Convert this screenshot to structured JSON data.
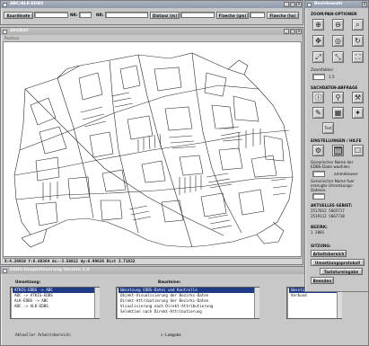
{
  "top_window": {
    "title": "ABC/ALK-EDBS",
    "koordinate_label": "Koordinate",
    "nr_label": "NR:",
    "nr2_label": "NR:",
    "distanz_label": "Distanz (m)",
    "flaeche_label": "Flaeche (qm)",
    "flaeche2_label": "Flaeche (ha)"
  },
  "map_window": {
    "title": "AKGRAF",
    "menu_label": "Position",
    "status_text": "X:4.26919 Y:6.88364 dx:-3.58812 dy:0.99636 Dist 3.71632"
  },
  "main_window": {
    "title": "EDBS-Hauptsteuerung Version 1.0",
    "umsetzung_label": "Umsetzung:",
    "umsetzung_items": [
      "ATKIS-EDBS -> ABC",
      "ABC -> ATKIS-EDBS",
      "ALK-EDBS -> ABC",
      "ABC -> ALK-EDBS"
    ],
    "umsetzung_selected": 0,
    "bausteine_label": "Bausteine:",
    "bausteine_items": [
      "Umsetzung EDBS-Datei und Kontrolle",
      "Objekt-Visualisierung der Bezirks-Daten",
      "Direkt-Attributierung der Bezirks-Daten",
      "Visualisierung nach Direkt-Attributierung",
      "Selektion nach Direkt-Attributierung"
    ],
    "bausteine_selected": 0,
    "meldung_label": "Meldung",
    "meldung_items": [
      "Umsetzu",
      "Verbund"
    ],
    "meldung_selected": 0,
    "aktueller_label": "Aktueller Arbeitsbereich:",
    "eingabe_label": "c-Lamgabe"
  },
  "right_panel": {
    "title": "Bezirkswahl",
    "zoom_section": "ZOOM/PAN-OPTIONEN",
    "zoomfaktor_label": "Zoomfaktor:",
    "zoomfaktor_value": "1.5",
    "sachdaten_section": "SACHDATEN-ABFRAGE",
    "text_label": "Text",
    "einstellungen_section": "EINSTELLUNGEN / HILFE",
    "generischer_label_1": "Generischer Name der",
    "generischer_label_2": "EDBS-Datei waehlen:",
    "generischer_value": "ammeteuser",
    "generischer2_label_1": "Generischer Name fuer",
    "generischer2_label_2": "erzeugte Umsetzungs-",
    "generischer2_label_3": "Dateien:",
    "aktuelles_label": "AKTUELLES GEBIET:",
    "aktuelles_line1": "2517012  5665717",
    "aktuelles_line2": "2519112  5667718",
    "bezirk_label": "BEZIRK:",
    "bezirk_value": "1  2001",
    "sitzung_label": "SITZUNG:",
    "arbeitsbereich_button": "Arbeitsbereich",
    "umsetzungsprotokoll_button": "Umsetzungsprotokoll",
    "tastatureingabe_button": "Tastatureingabe",
    "beenden_button": "Beenden"
  },
  "colors": {
    "titlebar_active": "#8e9aab",
    "selection": "#1f3b88",
    "map_lines": "#2a2a2a"
  },
  "icons": {
    "zoom_in": "zoom-in-icon",
    "zoom_out": "zoom-out-icon",
    "pan": "pan-icon",
    "extent": "full-extent-icon"
  }
}
